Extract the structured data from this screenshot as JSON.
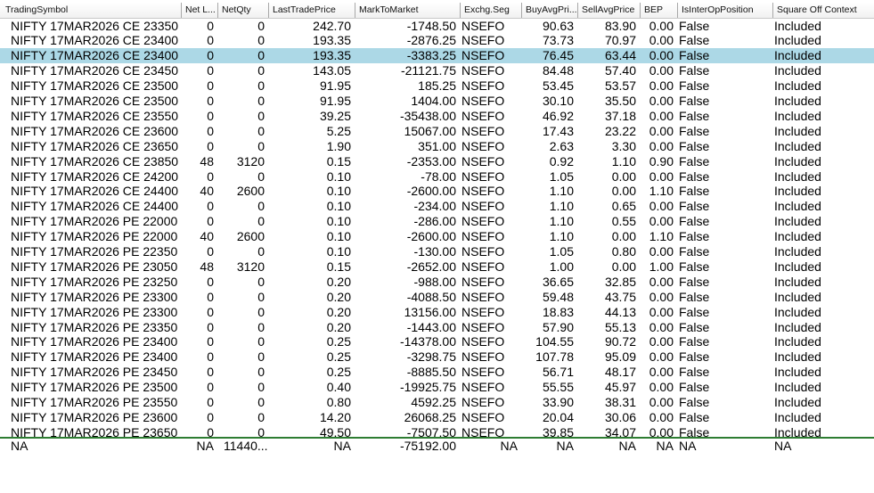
{
  "columns": [
    "TradingSymbol",
    "Net L...",
    "NetQty",
    "LastTradePrice",
    "MarkToMarket",
    "Exchg.Seg",
    "BuyAvgPri...",
    "SellAvgPrice",
    "BEP",
    "IsInterOpPosition",
    "Square Off Context"
  ],
  "rows": [
    [
      "NIFTY 17MAR2026 CE 23350",
      "0",
      "0",
      "242.70",
      "-1748.50",
      "NSEFO",
      "90.63",
      "83.90",
      "0.00",
      "False",
      "Included"
    ],
    [
      "NIFTY 17MAR2026 CE 23400",
      "0",
      "0",
      "193.35",
      "-2876.25",
      "NSEFO",
      "73.73",
      "70.97",
      "0.00",
      "False",
      "Included"
    ],
    [
      "NIFTY 17MAR2026 CE 23400",
      "0",
      "0",
      "193.35",
      "-3383.25",
      "NSEFO",
      "76.45",
      "63.44",
      "0.00",
      "False",
      "Included"
    ],
    [
      "NIFTY 17MAR2026 CE 23450",
      "0",
      "0",
      "143.05",
      "-21121.75",
      "NSEFO",
      "84.48",
      "57.40",
      "0.00",
      "False",
      "Included"
    ],
    [
      "NIFTY 17MAR2026 CE 23500",
      "0",
      "0",
      "91.95",
      "185.25",
      "NSEFO",
      "53.45",
      "53.57",
      "0.00",
      "False",
      "Included"
    ],
    [
      "NIFTY 17MAR2026 CE 23500",
      "0",
      "0",
      "91.95",
      "1404.00",
      "NSEFO",
      "30.10",
      "35.50",
      "0.00",
      "False",
      "Included"
    ],
    [
      "NIFTY 17MAR2026 CE 23550",
      "0",
      "0",
      "39.25",
      "-35438.00",
      "NSEFO",
      "46.92",
      "37.18",
      "0.00",
      "False",
      "Included"
    ],
    [
      "NIFTY 17MAR2026 CE 23600",
      "0",
      "0",
      "5.25",
      "15067.00",
      "NSEFO",
      "17.43",
      "23.22",
      "0.00",
      "False",
      "Included"
    ],
    [
      "NIFTY 17MAR2026 CE 23650",
      "0",
      "0",
      "1.90",
      "351.00",
      "NSEFO",
      "2.63",
      "3.30",
      "0.00",
      "False",
      "Included"
    ],
    [
      "NIFTY 17MAR2026 CE 23850",
      "48",
      "3120",
      "0.15",
      "-2353.00",
      "NSEFO",
      "0.92",
      "1.10",
      "0.90",
      "False",
      "Included"
    ],
    [
      "NIFTY 17MAR2026 CE 24200",
      "0",
      "0",
      "0.10",
      "-78.00",
      "NSEFO",
      "1.05",
      "0.00",
      "0.00",
      "False",
      "Included"
    ],
    [
      "NIFTY 17MAR2026 CE 24400",
      "40",
      "2600",
      "0.10",
      "-2600.00",
      "NSEFO",
      "1.10",
      "0.00",
      "1.10",
      "False",
      "Included"
    ],
    [
      "NIFTY 17MAR2026 CE 24400",
      "0",
      "0",
      "0.10",
      "-234.00",
      "NSEFO",
      "1.10",
      "0.65",
      "0.00",
      "False",
      "Included"
    ],
    [
      "NIFTY 17MAR2026 PE 22000",
      "0",
      "0",
      "0.10",
      "-286.00",
      "NSEFO",
      "1.10",
      "0.55",
      "0.00",
      "False",
      "Included"
    ],
    [
      "NIFTY 17MAR2026 PE 22000",
      "40",
      "2600",
      "0.10",
      "-2600.00",
      "NSEFO",
      "1.10",
      "0.00",
      "1.10",
      "False",
      "Included"
    ],
    [
      "NIFTY 17MAR2026 PE 22350",
      "0",
      "0",
      "0.10",
      "-130.00",
      "NSEFO",
      "1.05",
      "0.80",
      "0.00",
      "False",
      "Included"
    ],
    [
      "NIFTY 17MAR2026 PE 23050",
      "48",
      "3120",
      "0.15",
      "-2652.00",
      "NSEFO",
      "1.00",
      "0.00",
      "1.00",
      "False",
      "Included"
    ],
    [
      "NIFTY 17MAR2026 PE 23250",
      "0",
      "0",
      "0.20",
      "-988.00",
      "NSEFO",
      "36.65",
      "32.85",
      "0.00",
      "False",
      "Included"
    ],
    [
      "NIFTY 17MAR2026 PE 23300",
      "0",
      "0",
      "0.20",
      "-4088.50",
      "NSEFO",
      "59.48",
      "43.75",
      "0.00",
      "False",
      "Included"
    ],
    [
      "NIFTY 17MAR2026 PE 23300",
      "0",
      "0",
      "0.20",
      "13156.00",
      "NSEFO",
      "18.83",
      "44.13",
      "0.00",
      "False",
      "Included"
    ],
    [
      "NIFTY 17MAR2026 PE 23350",
      "0",
      "0",
      "0.20",
      "-1443.00",
      "NSEFO",
      "57.90",
      "55.13",
      "0.00",
      "False",
      "Included"
    ],
    [
      "NIFTY 17MAR2026 PE 23400",
      "0",
      "0",
      "0.25",
      "-14378.00",
      "NSEFO",
      "104.55",
      "90.72",
      "0.00",
      "False",
      "Included"
    ],
    [
      "NIFTY 17MAR2026 PE 23400",
      "0",
      "0",
      "0.25",
      "-3298.75",
      "NSEFO",
      "107.78",
      "95.09",
      "0.00",
      "False",
      "Included"
    ],
    [
      "NIFTY 17MAR2026 PE 23450",
      "0",
      "0",
      "0.25",
      "-8885.50",
      "NSEFO",
      "56.71",
      "48.17",
      "0.00",
      "False",
      "Included"
    ],
    [
      "NIFTY 17MAR2026 PE 23500",
      "0",
      "0",
      "0.40",
      "-19925.75",
      "NSEFO",
      "55.55",
      "45.97",
      "0.00",
      "False",
      "Included"
    ],
    [
      "NIFTY 17MAR2026 PE 23550",
      "0",
      "0",
      "0.80",
      "4592.25",
      "NSEFO",
      "33.90",
      "38.31",
      "0.00",
      "False",
      "Included"
    ],
    [
      "NIFTY 17MAR2026 PE 23600",
      "0",
      "0",
      "14.20",
      "26068.25",
      "NSEFO",
      "20.04",
      "30.06",
      "0.00",
      "False",
      "Included"
    ],
    [
      "NIFTY 17MAR2026 PE 23650",
      "0",
      "0",
      "49.50",
      "-7507.50",
      "NSEFO",
      "39.85",
      "34.07",
      "0.00",
      "False",
      "Included"
    ]
  ],
  "selected_row": 2,
  "footer": [
    "NA",
    "NA",
    "11440...",
    "NA",
    "-75192.00",
    "NA",
    "NA",
    "NA",
    "NA",
    "NA",
    "NA"
  ],
  "colors": {
    "selected_row": "#acd8e6",
    "footer_divider": "#2e7d32"
  }
}
